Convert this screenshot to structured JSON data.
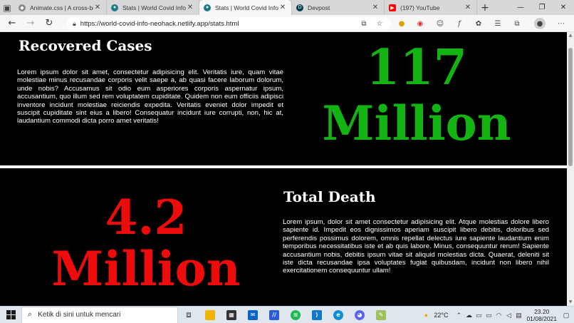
{
  "browser": {
    "tabs": [
      {
        "label": "Animate.css | A cross-bro",
        "icon": "animate-icon",
        "color": "#888888",
        "active": false
      },
      {
        "label": "Stats | World Covid Info",
        "icon": "site-icon",
        "color": "#1b7a8a",
        "active": false
      },
      {
        "label": "Stats | World Covid Info",
        "icon": "site-icon",
        "color": "#1b7a8a",
        "active": true
      },
      {
        "label": "Devpost",
        "icon": "devpost-icon",
        "color": "#003e54",
        "active": false
      },
      {
        "label": "(197) YouTube",
        "icon": "youtube-icon",
        "color": "#ff0000",
        "active": false
      }
    ],
    "url": "https://world-covid-info-neohack.netlify.app/stats.html"
  },
  "sections": {
    "recovered": {
      "heading": "Recovered Cases",
      "text": "Lorem ipsum dolor sit amet, consectetur adipisicing elit. Veritatis iure, quam vitae molestiae minus recusandae corporis velit saepe a, ab quasi facere laborum dolorum, unde nobis? Accusamus sit odio eum asperiores corporis aspernatur ipsum, accusantium, quo illum sed rem voluptatem cupiditate. Quidem non eum officiis adipisci inventore incidunt molestiae reiciendis expedita. Veritatis eveniet dolor impedit et suscipit cupiditate sint eius a libero! Consequatur incidunt iure corrupti, non, hic at, laudantium commodi dicta porro amet veritatis!",
      "number": "117",
      "unit": "Million",
      "color": "#12b312"
    },
    "death": {
      "heading": "Total Death",
      "text": "Lorem ipsum, dolor sit amet consectetur adipisicing elit. Atque molestias dolore libero sapiente id. Impedit eos dignissimos aperiam suscipit libero debitis, doloribus sed perferendis possimus dolorem, omnis repellat delectus iure sapiente laudantium enim temporibus necessitatibus iste et ab quis labore. Minus, consequuntur rerum! Sapiente accusantium nobis, debitis ipsum vitae sit aliquid molestias dicta. Quaerat, deleniti sit iste dicta recusandae ipsa voluptates fugiat quibusdam, incidunt non libero nihil exercitationem consequuntur ullam!",
      "number": "4.2",
      "unit": "Million",
      "color": "#ee0b0b"
    }
  },
  "taskbar": {
    "search_placeholder": "Ketik di sini untuk mencari",
    "weather": "22°C",
    "time": "23.20",
    "date": "01/08/2021"
  }
}
